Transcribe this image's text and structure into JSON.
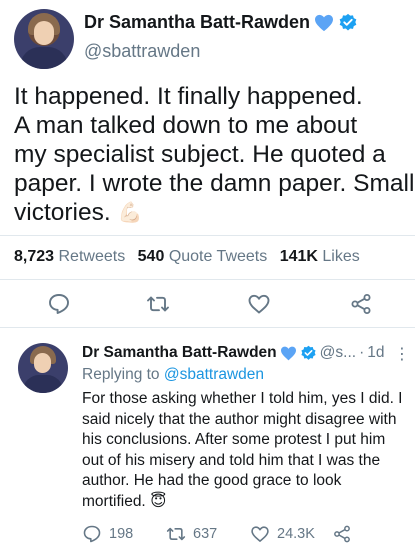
{
  "tweet": {
    "author_name": "Dr Samantha Batt-Rawden",
    "handle": "@sbattrawden",
    "text_lines": [
      "It happened. It finally happened.",
      "A man talked down to me about",
      "my specialist subject. He quoted a",
      "paper. I wrote the damn paper. Small",
      "victories."
    ],
    "emoji": "💪🏻",
    "retweets_count": "8,723",
    "retweets_label": "Retweets",
    "quote_count": "540",
    "quote_label": "Quote Tweets",
    "likes_count": "141K",
    "likes_label": "Likes",
    "icons": [
      "reply-icon",
      "retweet-icon",
      "like-icon",
      "share-icon"
    ]
  },
  "reply": {
    "author_name": "Dr Samantha Batt-Rawden",
    "handle": "@s...",
    "separator": "·",
    "time": "1d",
    "more": "⋮",
    "replying_prefix": "Replying to",
    "replying_to": "@sbattrawden",
    "text_lines": [
      "For those asking whether I told him, yes I did. I",
      "said nicely that the author might disagree with",
      "his conclusions. After some protest I put him",
      "out of his misery and told him that I was the",
      "author. He had the good grace to look",
      "mortified."
    ],
    "emoji": "😇",
    "reply_count": "198",
    "retweet_count": "637",
    "like_count": "24.3K"
  },
  "colors": {
    "accent": "#1b95e0",
    "muted": "#657786",
    "text": "#14171a",
    "heart_badge": "#5ba4f5"
  }
}
